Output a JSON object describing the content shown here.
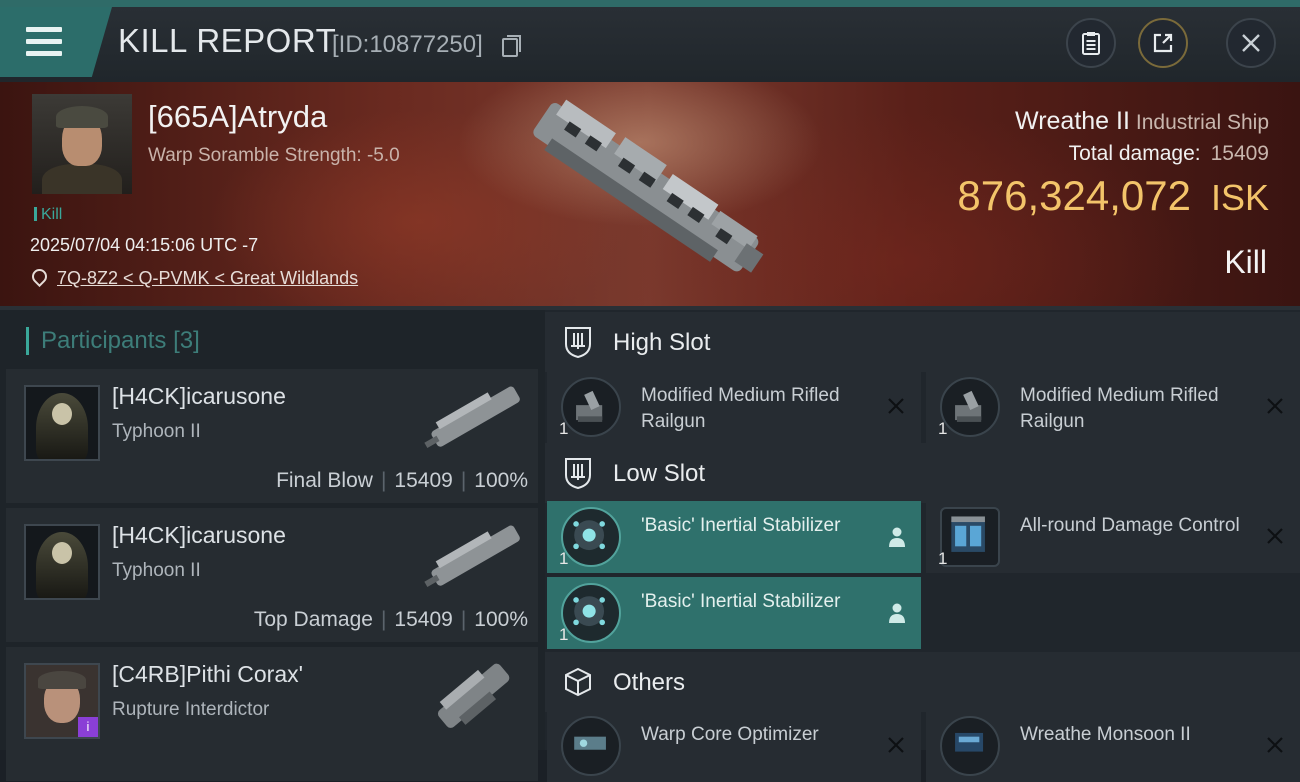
{
  "header": {
    "title": "KILL REPORT",
    "report_id": "[ID:10877250]",
    "icons": [
      "menu-icon",
      "copy-icon",
      "clipboard-icon",
      "share-icon",
      "close-icon"
    ]
  },
  "victim": {
    "name": "[665A]Atryda",
    "warp_scramble": "Warp Soramble Strength: -5.0",
    "kill_tag": "Kill",
    "datetime": "2025/07/04 04:15:06 UTC -7",
    "location": "7Q-8Z2 < Q-PVMK < Great Wildlands",
    "ship_name": "Wreathe II",
    "ship_class": "Industrial Ship",
    "total_damage_label": "Total damage:",
    "total_damage_value": "15409",
    "isk_value": "876,324,072",
    "isk_unit": "ISK",
    "result": "Kill"
  },
  "participants": {
    "title": "Participants",
    "count": "[3]",
    "items": [
      {
        "name": "[H4CK]icarusone",
        "ship": "Typhoon II",
        "role": "Final Blow",
        "damage": "15409",
        "percent": "100%"
      },
      {
        "name": "[H4CK]icarusone",
        "ship": "Typhoon II",
        "role": "Top Damage",
        "damage": "15409",
        "percent": "100%"
      },
      {
        "name": "[C4RB]Pithi Corax'",
        "ship": "Rupture Interdictor"
      }
    ],
    "separator": "|"
  },
  "fittings": {
    "high_slot": {
      "title": "High Slot",
      "modules": [
        {
          "name": "Modified Medium Rifled Railgun",
          "qty": "1"
        },
        {
          "name": "Modified Medium Rifled Railgun",
          "qty": "1"
        }
      ]
    },
    "low_slot": {
      "title": "Low Slot",
      "modules": [
        {
          "name": "'Basic' Inertial Stabilizer",
          "qty": "1"
        },
        {
          "name": "All-round Damage Control",
          "qty": "1"
        },
        {
          "name": "'Basic' Inertial Stabilizer",
          "qty": "1"
        }
      ]
    },
    "others": {
      "title": "Others",
      "modules": [
        {
          "name": "Warp Core Optimizer"
        },
        {
          "name": "Wreathe Monsoon II"
        }
      ]
    }
  },
  "colors": {
    "accent_teal": "#2f716c",
    "isk_gold": "#f3c46a",
    "hero_red": "#6a2a20"
  }
}
